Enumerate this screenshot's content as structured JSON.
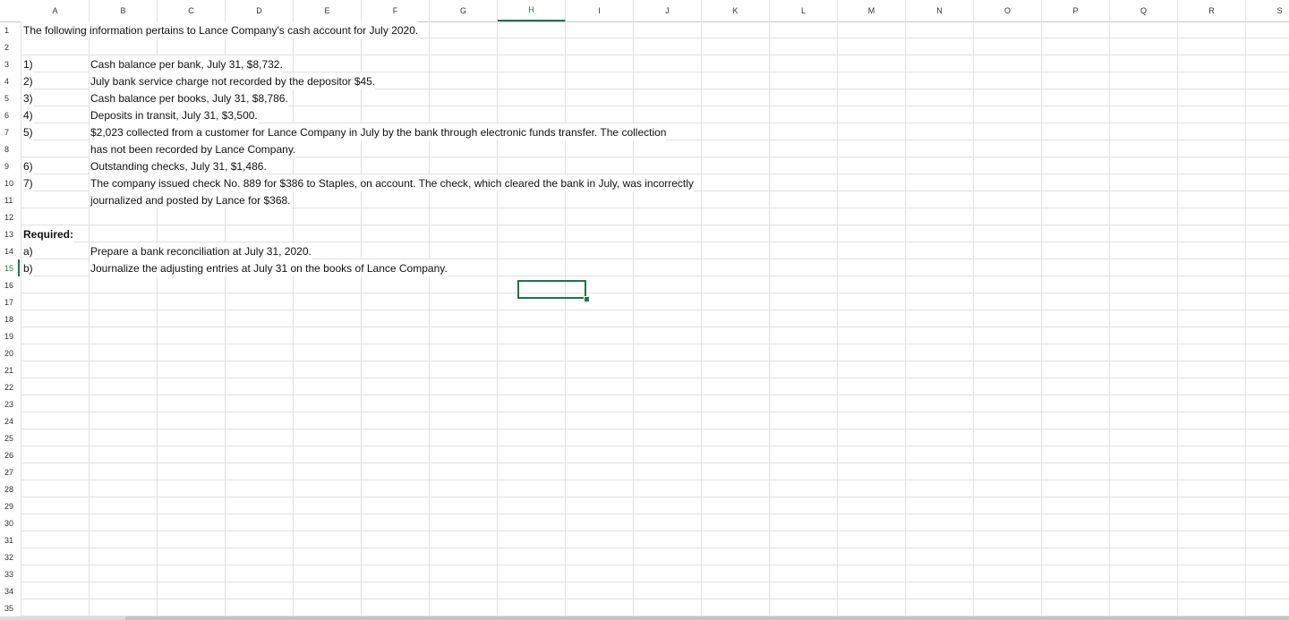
{
  "columns": [
    "A",
    "B",
    "C",
    "D",
    "E",
    "F",
    "G",
    "H",
    "I",
    "J",
    "K",
    "L",
    "M",
    "N",
    "O",
    "P",
    "Q",
    "R",
    "S"
  ],
  "selected_column": "H",
  "rows": [
    "1",
    "2",
    "3",
    "4",
    "5",
    "6",
    "7",
    "8",
    "9",
    "10",
    "11",
    "12",
    "13",
    "14",
    "15",
    "16",
    "17",
    "18",
    "19",
    "20",
    "21",
    "22",
    "23",
    "24",
    "25",
    "26",
    "27",
    "28",
    "29",
    "30",
    "31",
    "32",
    "33",
    "34",
    "35"
  ],
  "selected_row": "15",
  "active_cell": "H15",
  "cells": [
    {
      "row": 1,
      "col": "A",
      "text": "The following information pertains to Lance Company's cash account for July 2020.",
      "bold": false
    },
    {
      "row": 3,
      "col": "A",
      "text": "1)",
      "bold": false
    },
    {
      "row": 3,
      "col": "B",
      "text": "Cash balance per bank, July 31, $8,732.",
      "bold": false
    },
    {
      "row": 4,
      "col": "A",
      "text": "2)",
      "bold": false
    },
    {
      "row": 4,
      "col": "B",
      "text": "July bank service charge not recorded by the depositor $45.",
      "bold": false
    },
    {
      "row": 5,
      "col": "A",
      "text": "3)",
      "bold": false
    },
    {
      "row": 5,
      "col": "B",
      "text": "Cash balance per books, July 31, $8,786.",
      "bold": false
    },
    {
      "row": 6,
      "col": "A",
      "text": "4)",
      "bold": false
    },
    {
      "row": 6,
      "col": "B",
      "text": "Deposits in transit, July 31, $3,500.",
      "bold": false
    },
    {
      "row": 7,
      "col": "A",
      "text": "5)",
      "bold": false
    },
    {
      "row": 7,
      "col": "B",
      "text": "$2,023 collected from a customer for Lance Company in July by the bank through electronic funds transfer. The collection",
      "bold": false
    },
    {
      "row": 8,
      "col": "B",
      "text": "has not been recorded by Lance Company.",
      "bold": false
    },
    {
      "row": 9,
      "col": "A",
      "text": "6)",
      "bold": false
    },
    {
      "row": 9,
      "col": "B",
      "text": "Outstanding checks, July 31, $1,486.",
      "bold": false
    },
    {
      "row": 10,
      "col": "A",
      "text": "7)",
      "bold": false
    },
    {
      "row": 10,
      "col": "B",
      "text": "The company issued check No. 889 for $386 to Staples, on account. The check, which cleared the bank in July, was incorrectly",
      "bold": false
    },
    {
      "row": 11,
      "col": "B",
      "text": "journalized and posted by Lance for $368.",
      "bold": false
    },
    {
      "row": 13,
      "col": "A",
      "text": "Required:",
      "bold": true
    },
    {
      "row": 14,
      "col": "A",
      "text": "a)",
      "bold": false
    },
    {
      "row": 14,
      "col": "B",
      "text": "Prepare a bank reconciliation at July 31, 2020.",
      "bold": false
    },
    {
      "row": 15,
      "col": "A",
      "text": "b)",
      "bold": false
    },
    {
      "row": 15,
      "col": "B",
      "text": "Journalize the adjusting entries at July 31 on the books of Lance Company.",
      "bold": false
    }
  ]
}
